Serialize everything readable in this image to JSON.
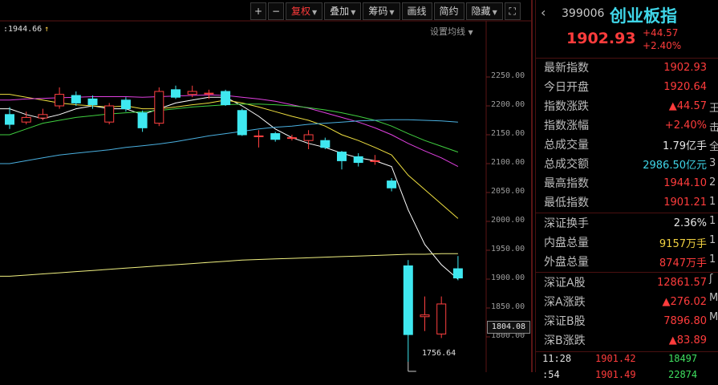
{
  "toolbar": {
    "plus": "+",
    "minus": "−",
    "fuquan": "复权",
    "diejia": "叠加",
    "chouma": "筹码",
    "huaxian": "画线",
    "jianyue": "简约",
    "yincang": "隐藏",
    "fullscreen_icon": "fullscreen-icon"
  },
  "chart": {
    "cursor_value": ":1944.66",
    "ma_setting": "设置均线",
    "current_price_tag": "1804.08",
    "low_label": "1756.64",
    "y_ticks": [
      "2250.00",
      "2200.00",
      "2150.00",
      "2100.00",
      "2050.00",
      "2000.00",
      "1950.00",
      "1900.00",
      "1850.00",
      "1800.00"
    ]
  },
  "chart_data": {
    "type": "candlestick",
    "ylim": [
      1745,
      2268
    ],
    "candles": [
      {
        "o": 2185,
        "c": 2168,
        "h": 2198,
        "l": 2160
      },
      {
        "o": 2172,
        "c": 2180,
        "h": 2190,
        "l": 2168
      },
      {
        "o": 2179,
        "c": 2185,
        "h": 2195,
        "l": 2175
      },
      {
        "o": 2200,
        "c": 2220,
        "h": 2232,
        "l": 2195
      },
      {
        "o": 2218,
        "c": 2205,
        "h": 2225,
        "l": 2200
      },
      {
        "o": 2212,
        "c": 2202,
        "h": 2218,
        "l": 2195
      },
      {
        "o": 2172,
        "c": 2200,
        "h": 2205,
        "l": 2168
      },
      {
        "o": 2210,
        "c": 2195,
        "h": 2215,
        "l": 2190
      },
      {
        "o": 2188,
        "c": 2162,
        "h": 2192,
        "l": 2155
      },
      {
        "o": 2170,
        "c": 2225,
        "h": 2232,
        "l": 2165
      },
      {
        "o": 2228,
        "c": 2215,
        "h": 2235,
        "l": 2212
      },
      {
        "o": 2220,
        "c": 2225,
        "h": 2235,
        "l": 2215
      },
      {
        "o": 2222,
        "c": 2222,
        "h": 2228,
        "l": 2212
      },
      {
        "o": 2225,
        "c": 2202,
        "h": 2228,
        "l": 2200
      },
      {
        "o": 2192,
        "c": 2150,
        "h": 2195,
        "l": 2148
      },
      {
        "o": 2148,
        "c": 2148,
        "h": 2158,
        "l": 2128
      },
      {
        "o": 2152,
        "c": 2142,
        "h": 2155,
        "l": 2138
      },
      {
        "o": 2145,
        "c": 2145,
        "h": 2150,
        "l": 2140
      },
      {
        "o": 2140,
        "c": 2150,
        "h": 2158,
        "l": 2125
      },
      {
        "o": 2140,
        "c": 2128,
        "h": 2145,
        "l": 2125
      },
      {
        "o": 2120,
        "c": 2105,
        "h": 2122,
        "l": 2090
      },
      {
        "o": 2112,
        "c": 2102,
        "h": 2118,
        "l": 2095
      },
      {
        "o": 2105,
        "c": 2105,
        "h": 2115,
        "l": 2098
      },
      {
        "o": 2070,
        "c": 2058,
        "h": 2075,
        "l": 2052
      },
      {
        "o": 1923,
        "c": 1804,
        "h": 1933,
        "l": 1757
      },
      {
        "o": 1835,
        "c": 1838,
        "h": 1870,
        "l": 1810
      },
      {
        "o": 1805,
        "c": 1857,
        "h": 1870,
        "l": 1798
      },
      {
        "o": 1918,
        "c": 1902,
        "h": 1940,
        "l": 1898
      }
    ],
    "ma_lines": [
      {
        "color": "#ffffff",
        "values": [
          2195,
          2185,
          2178,
          2185,
          2195,
          2200,
          2195,
          2195,
          2185,
          2195,
          2205,
          2210,
          2215,
          2215,
          2200,
          2182,
          2160,
          2145,
          2135,
          2128,
          2118,
          2110,
          2105,
          2095,
          2020,
          1960,
          1925,
          1900
        ]
      },
      {
        "color": "#f0e040",
        "values": [
          2220,
          2215,
          2210,
          2205,
          2202,
          2200,
          2198,
          2200,
          2195,
          2195,
          2198,
          2202,
          2205,
          2210,
          2205,
          2198,
          2190,
          2182,
          2175,
          2165,
          2150,
          2140,
          2128,
          2115,
          2080,
          2055,
          2030,
          2005
        ]
      },
      {
        "color": "#e040e0",
        "values": [
          2210,
          2212,
          2213,
          2214,
          2215,
          2216,
          2216,
          2216,
          2215,
          2216,
          2217,
          2218,
          2219,
          2218,
          2215,
          2212,
          2208,
          2202,
          2196,
          2188,
          2180,
          2172,
          2162,
          2150,
          2135,
          2122,
          2110,
          2095
        ]
      },
      {
        "color": "#40d040",
        "values": [
          2150,
          2160,
          2170,
          2175,
          2180,
          2183,
          2186,
          2188,
          2190,
          2192,
          2195,
          2198,
          2200,
          2202,
          2203,
          2203,
          2202,
          2200,
          2197,
          2193,
          2188,
          2182,
          2175,
          2165,
          2152,
          2140,
          2130,
          2120
        ]
      },
      {
        "color": "#4ab0e0",
        "values": [
          2100,
          2105,
          2110,
          2115,
          2118,
          2121,
          2124,
          2128,
          2131,
          2134,
          2138,
          2143,
          2148,
          2152,
          2156,
          2160,
          2163,
          2165,
          2168,
          2170,
          2172,
          2174,
          2175,
          2176,
          2176,
          2175,
          2174,
          2172
        ]
      },
      {
        "color": "#f0f080",
        "values": [
          1905,
          1907,
          1909,
          1911,
          1913,
          1915,
          1917,
          1919,
          1921,
          1923,
          1925,
          1927,
          1929,
          1931,
          1933,
          1934,
          1935,
          1936,
          1937,
          1938,
          1939,
          1940,
          1941,
          1942,
          1943,
          1943,
          1944,
          1944
        ]
      }
    ]
  },
  "panel": {
    "back_icon": "back-arrow-icon",
    "back_glyph": "‹",
    "code": "399006",
    "name": "创业板指",
    "price": "1902.93",
    "change": "+44.57",
    "change_pct": "+2.40%",
    "rows1": [
      {
        "label": "最新指数",
        "value": "1902.93",
        "cls": "v-red"
      },
      {
        "label": "今日开盘",
        "value": "1920.64",
        "cls": "v-red"
      },
      {
        "label": "指数涨跌",
        "value": "▲44.57",
        "cls": "v-red"
      },
      {
        "label": "指数涨幅",
        "value": "+2.40%",
        "cls": "v-red"
      },
      {
        "label": "总成交量",
        "value": "1.79亿手",
        "cls": "v-white"
      },
      {
        "label": "总成交额",
        "value": "2986.50亿元",
        "cls": "v-cyan"
      },
      {
        "label": "最高指数",
        "value": "1944.10",
        "cls": "v-red"
      },
      {
        "label": "最低指数",
        "value": "1901.21",
        "cls": "v-red"
      }
    ],
    "rows2": [
      {
        "label": "深证换手",
        "value": "2.36%",
        "cls": "v-white"
      },
      {
        "label": "内盘总量",
        "value": "9157万手",
        "cls": "v-yellow"
      },
      {
        "label": "外盘总量",
        "value": "8747万手",
        "cls": "v-red"
      }
    ],
    "rows3": [
      {
        "label": "深证A股",
        "value": "12861.57",
        "cls": "v-red"
      },
      {
        "label": "深A涨跌",
        "value": "▲276.02",
        "cls": "v-red"
      },
      {
        "label": "深证B股",
        "value": "7896.80",
        "cls": "v-red"
      },
      {
        "label": "深B涨跌",
        "value": "▲83.89",
        "cls": "v-red"
      }
    ],
    "edge_chars": [
      "王",
      "击",
      "全",
      "3",
      "2",
      "1",
      "1",
      "1",
      "1",
      "ʃ",
      "M",
      "M"
    ],
    "ticks": [
      {
        "time": "11:28",
        "price": "1901.42",
        "vol": "18497"
      },
      {
        "time": ":54",
        "price": "1901.49",
        "vol": "22874"
      }
    ]
  }
}
